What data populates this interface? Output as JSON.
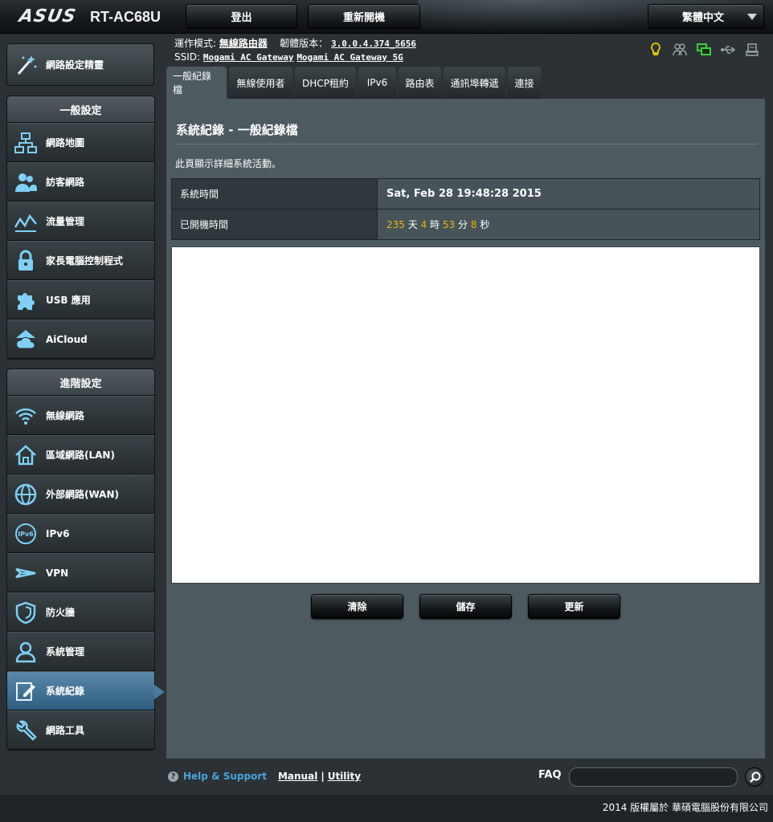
{
  "header": {
    "brand": "ASUS",
    "model": "RT-AC68U",
    "logout_label": "登出",
    "reboot_label": "重新開機",
    "language": "繁體中文"
  },
  "info": {
    "mode_label": "運作模式:",
    "mode_value": "無線路由器",
    "firmware_label": "韌體版本：",
    "firmware_value": "3.0.0.4.374_5656",
    "ssid_label": "SSID:",
    "ssid_1": "Mogami AC Gateway",
    "ssid_2": "Mogami AC Gateway 5G"
  },
  "status_icons": [
    "lightbulb-icon",
    "clients-icon",
    "network-icon",
    "usb-icon",
    "printer-icon"
  ],
  "sidebar": {
    "wizard_label": "網路設定精靈",
    "general_title": "一般設定",
    "general_items": [
      {
        "label": "網路地圖",
        "icon": "network-map-icon"
      },
      {
        "label": "訪客網路",
        "icon": "guest-network-icon"
      },
      {
        "label": "流量管理",
        "icon": "traffic-icon"
      },
      {
        "label": "家長電腦控制程式",
        "icon": "lock-icon"
      },
      {
        "label": "USB 應用",
        "icon": "usb-app-icon"
      },
      {
        "label": "AiCloud",
        "icon": "cloud-icon"
      }
    ],
    "advanced_title": "進階設定",
    "advanced_items": [
      {
        "label": "無線網路",
        "icon": "wifi-icon"
      },
      {
        "label": "區域網路(LAN)",
        "icon": "home-icon"
      },
      {
        "label": "外部網路(WAN)",
        "icon": "globe-icon"
      },
      {
        "label": "IPv6",
        "icon": "ipv6-icon"
      },
      {
        "label": "VPN",
        "icon": "vpn-icon"
      },
      {
        "label": "防火牆",
        "icon": "shield-icon"
      },
      {
        "label": "系統管理",
        "icon": "admin-icon"
      },
      {
        "label": "系統紀錄",
        "icon": "log-icon"
      },
      {
        "label": "網路工具",
        "icon": "tools-icon"
      }
    ]
  },
  "tabs": [
    "一般紀錄檔",
    "無線使用者",
    "DHCP租約",
    "IPv6",
    "路由表",
    "通訊埠轉遞",
    "連接"
  ],
  "main": {
    "title": "系統紀錄 - 一般紀錄檔",
    "description": "此頁顯示詳細系統活動。",
    "system_time_label": "系統時間",
    "system_time_value": "Sat, Feb 28 19:48:28 2015",
    "uptime_label": "已開機時間",
    "uptime": {
      "days": "235",
      "days_unit": "天",
      "hours": "4",
      "hours_unit": "時",
      "minutes": "53",
      "minutes_unit": "分",
      "seconds": "8",
      "seconds_unit": "秒"
    },
    "log_content": "",
    "clear_label": "清除",
    "save_label": "儲存",
    "refresh_label": "更新"
  },
  "footer": {
    "help_label": "Help & Support",
    "manual_label": "Manual",
    "separator": "|",
    "utility_label": "Utility",
    "faq_label": "FAQ",
    "copyright": "2014 版權屬於 華碩電腦股份有限公司"
  },
  "colors": {
    "accent": "#4aa3dd",
    "uptime_number": "#f0b400",
    "active_item": "#4b7a9c"
  }
}
